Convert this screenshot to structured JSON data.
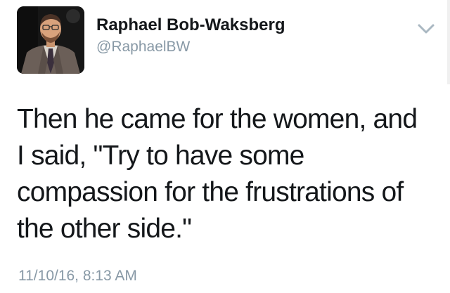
{
  "tweet": {
    "author": {
      "display_name": "Raphael Bob-Waksberg",
      "handle": "@RaphaelBW"
    },
    "text_lines": [
      "Then he came for the women, and",
      "I said, \"Try to have some",
      "compassion for the frustrations of",
      "the other side.\""
    ],
    "timestamp": "11/10/16, 8:13 AM",
    "menu_icon": "chevron-down-icon"
  },
  "colors": {
    "text": "#14171a",
    "secondary": "#8899a6",
    "background": "#ffffff"
  }
}
